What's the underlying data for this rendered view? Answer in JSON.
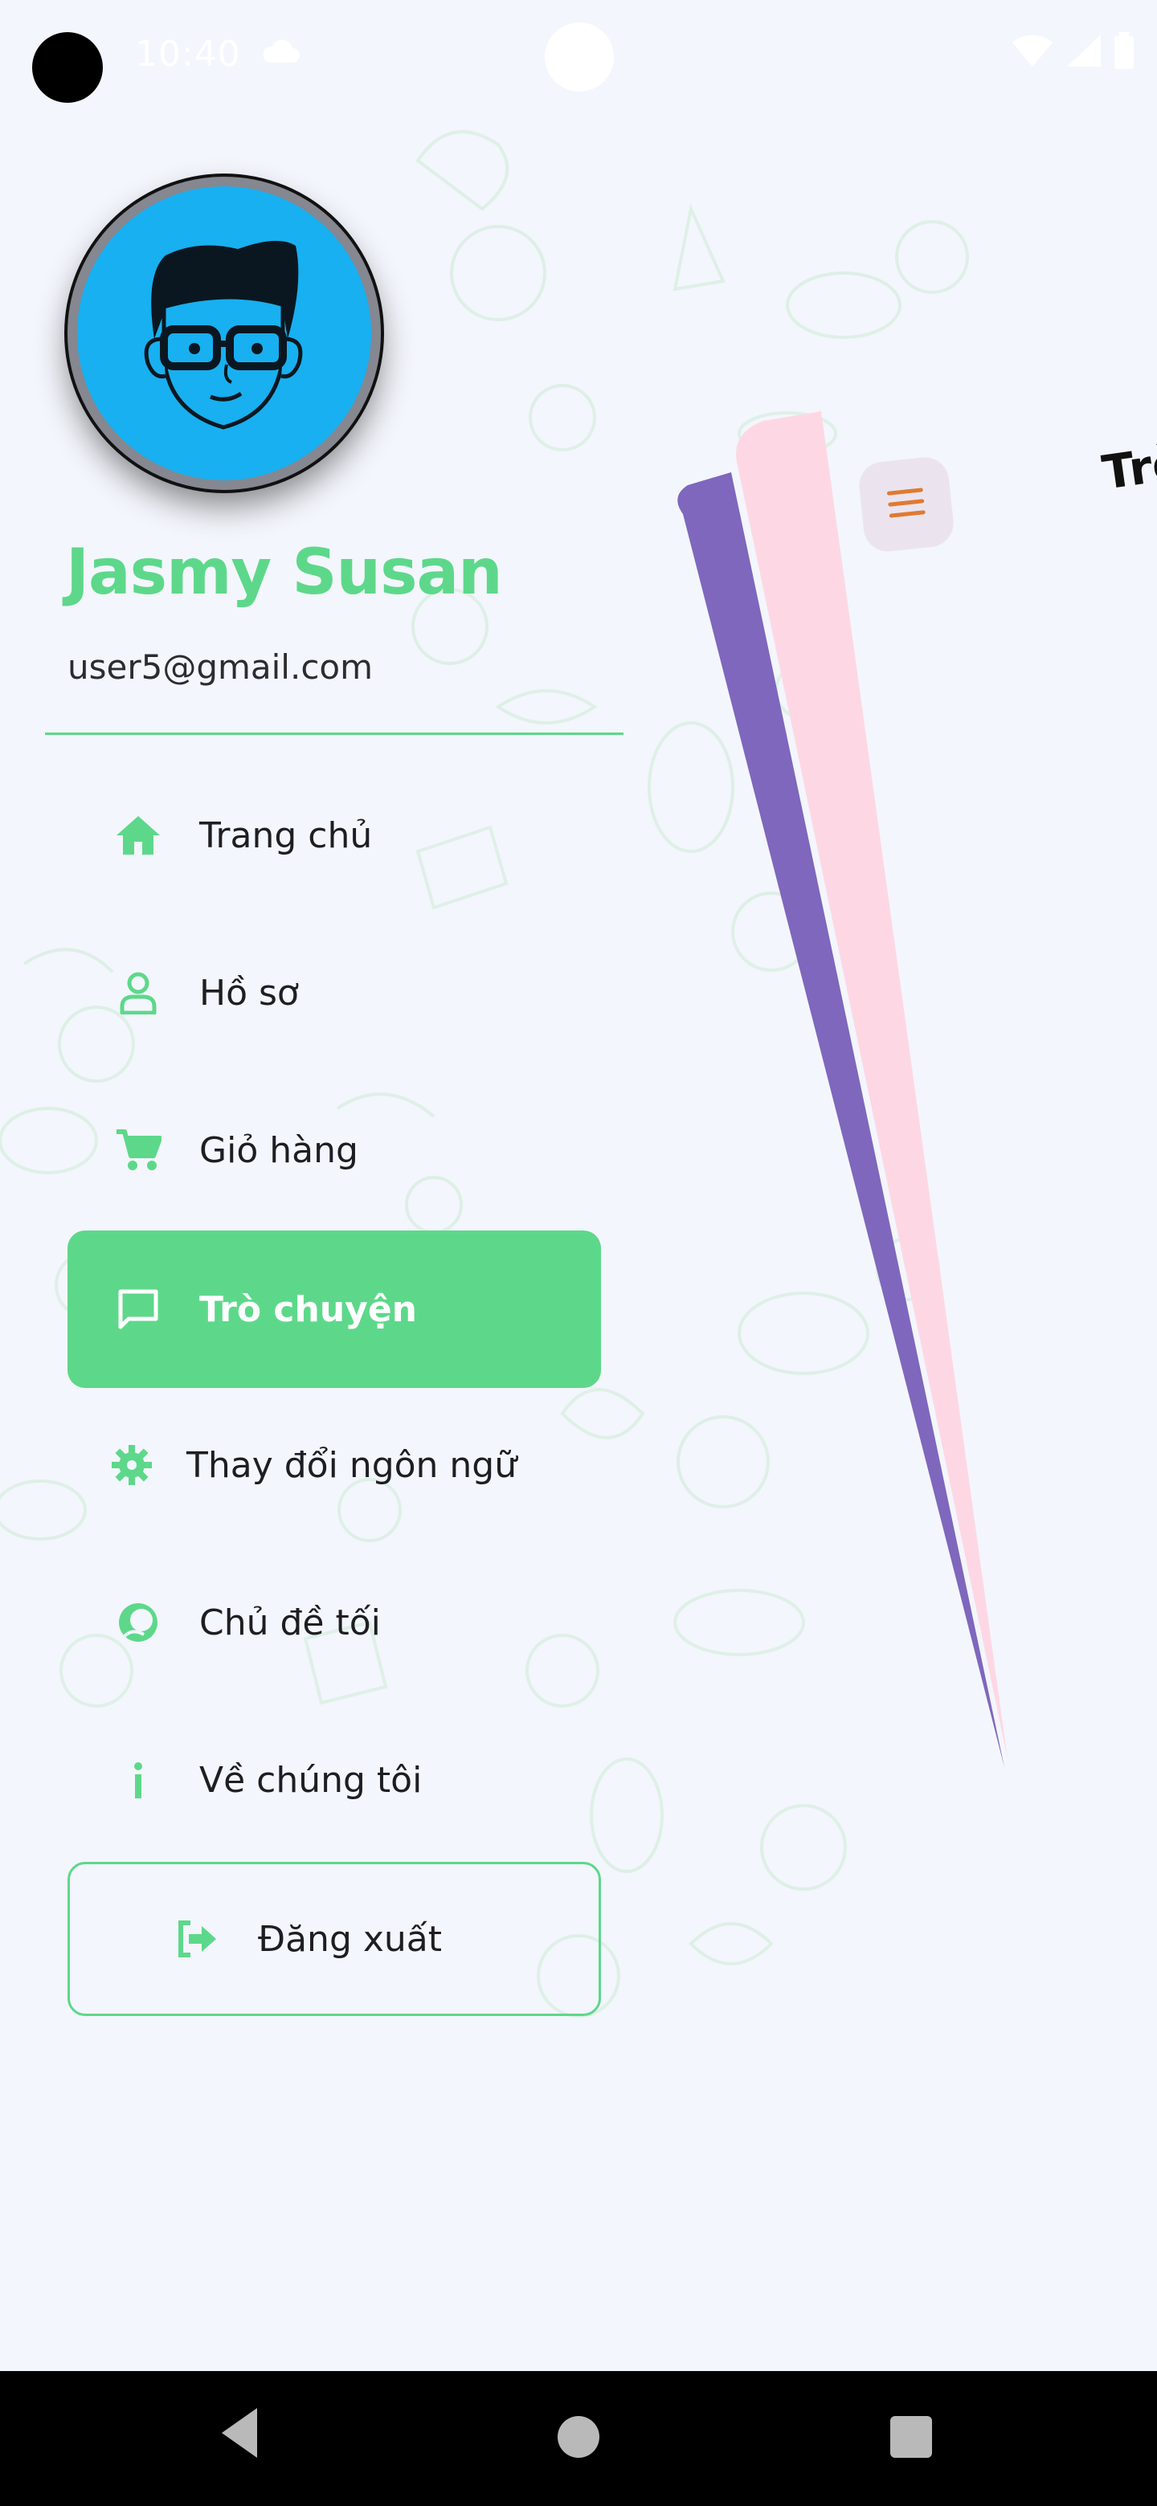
{
  "status_bar": {
    "time": "10:40",
    "icons": [
      "cloud-icon",
      "wifi-icon",
      "signal-icon",
      "battery-icon"
    ]
  },
  "profile": {
    "name": "Jasmy Susan",
    "email": "user5@gmail.com",
    "avatar": "cartoon-man-with-glasses"
  },
  "menu": {
    "items": [
      {
        "label": "Trang chủ",
        "icon": "home-icon",
        "active": false
      },
      {
        "label": "Hồ sơ",
        "icon": "user-icon",
        "active": false
      },
      {
        "label": "Giỏ hàng",
        "icon": "cart-icon",
        "active": false
      },
      {
        "label": "Trò chuyện",
        "icon": "chat-icon",
        "active": true
      },
      {
        "label": "Thay đổi ngôn ngữ",
        "icon": "gear-icon",
        "active": false
      },
      {
        "label": "Chủ đề tối",
        "icon": "theme-icon",
        "active": false
      },
      {
        "label": "Về chúng tôi",
        "icon": "info-icon",
        "active": false
      }
    ],
    "logout_label": "Đăng xuất"
  },
  "screen": {
    "title": "Trò",
    "menu_icon": "hamburger-icon"
  },
  "colors": {
    "accent": "#5dd88a",
    "background": "#f3f6fc",
    "avatar_bg": "#18b0f0",
    "card_purple": "#7e67bd",
    "card_pink": "#fdd8e4",
    "menu_icon": "#e07a32"
  },
  "nav": {
    "buttons": [
      "back-icon",
      "home-circle-icon",
      "recents-icon"
    ]
  }
}
